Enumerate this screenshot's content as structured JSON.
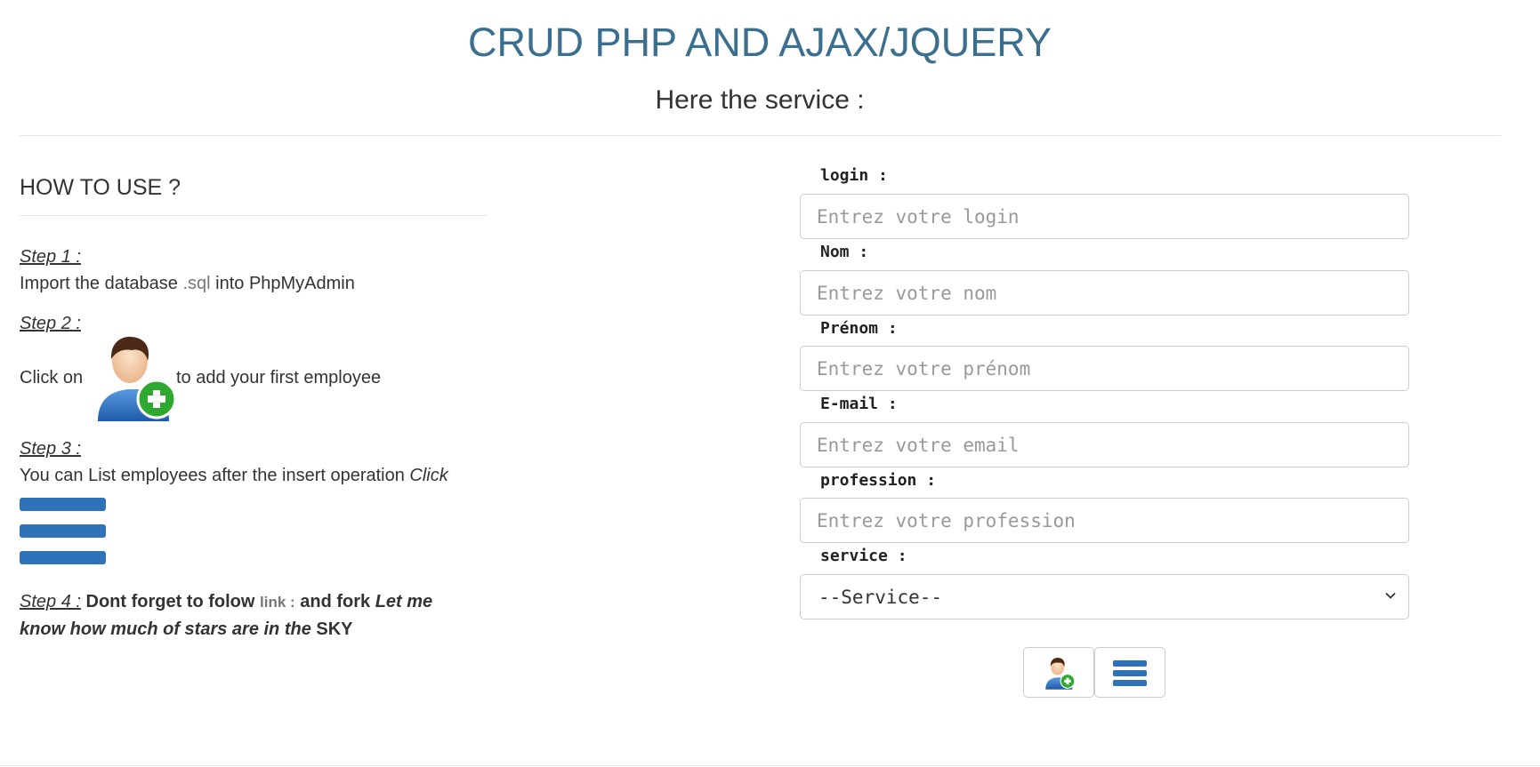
{
  "header": {
    "title": "CRUD PHP AND AJAX/JQUERY",
    "subtitle": "Here the service :"
  },
  "howto": {
    "title": "HOW TO USE ?",
    "step1": {
      "label": "Step 1 :",
      "text_before": "Import the database ",
      "file": ".sql",
      "text_after": " into PhpMyAdmin"
    },
    "step2": {
      "label": "Step 2 :",
      "text_before": "Click on",
      "icon": "user-add-icon",
      "text_after": "to add your first employee"
    },
    "step3": {
      "label": "Step 3 :",
      "text": "You can List employees after the insert operation ",
      "click": "Click",
      "icon": "list-menu-icon"
    },
    "step4": {
      "label": "Step 4 :",
      "text1": " Dont forget to folow ",
      "link": "link :",
      "text2": " and fork ",
      "text3": "Let me know how much of stars are in the",
      "text4": " SKY"
    }
  },
  "form": {
    "login": {
      "label": "login :",
      "placeholder": "Entrez votre login"
    },
    "nom": {
      "label": "Nom :",
      "placeholder": "Entrez votre nom"
    },
    "prenom": {
      "label": "Prénom :",
      "placeholder": "Entrez votre prénom"
    },
    "email": {
      "label": "E-mail :",
      "placeholder": "Entrez votre email"
    },
    "profession": {
      "label": "profession :",
      "placeholder": "Entrez votre profession"
    },
    "service": {
      "label": "service :",
      "selected": "--Service--"
    },
    "buttons": {
      "add_icon": "user-add-icon",
      "list_icon": "list-menu-icon"
    }
  },
  "colors": {
    "title": "#3a6f8f",
    "accent": "#2e73b8",
    "plus": "#2fa82f"
  }
}
